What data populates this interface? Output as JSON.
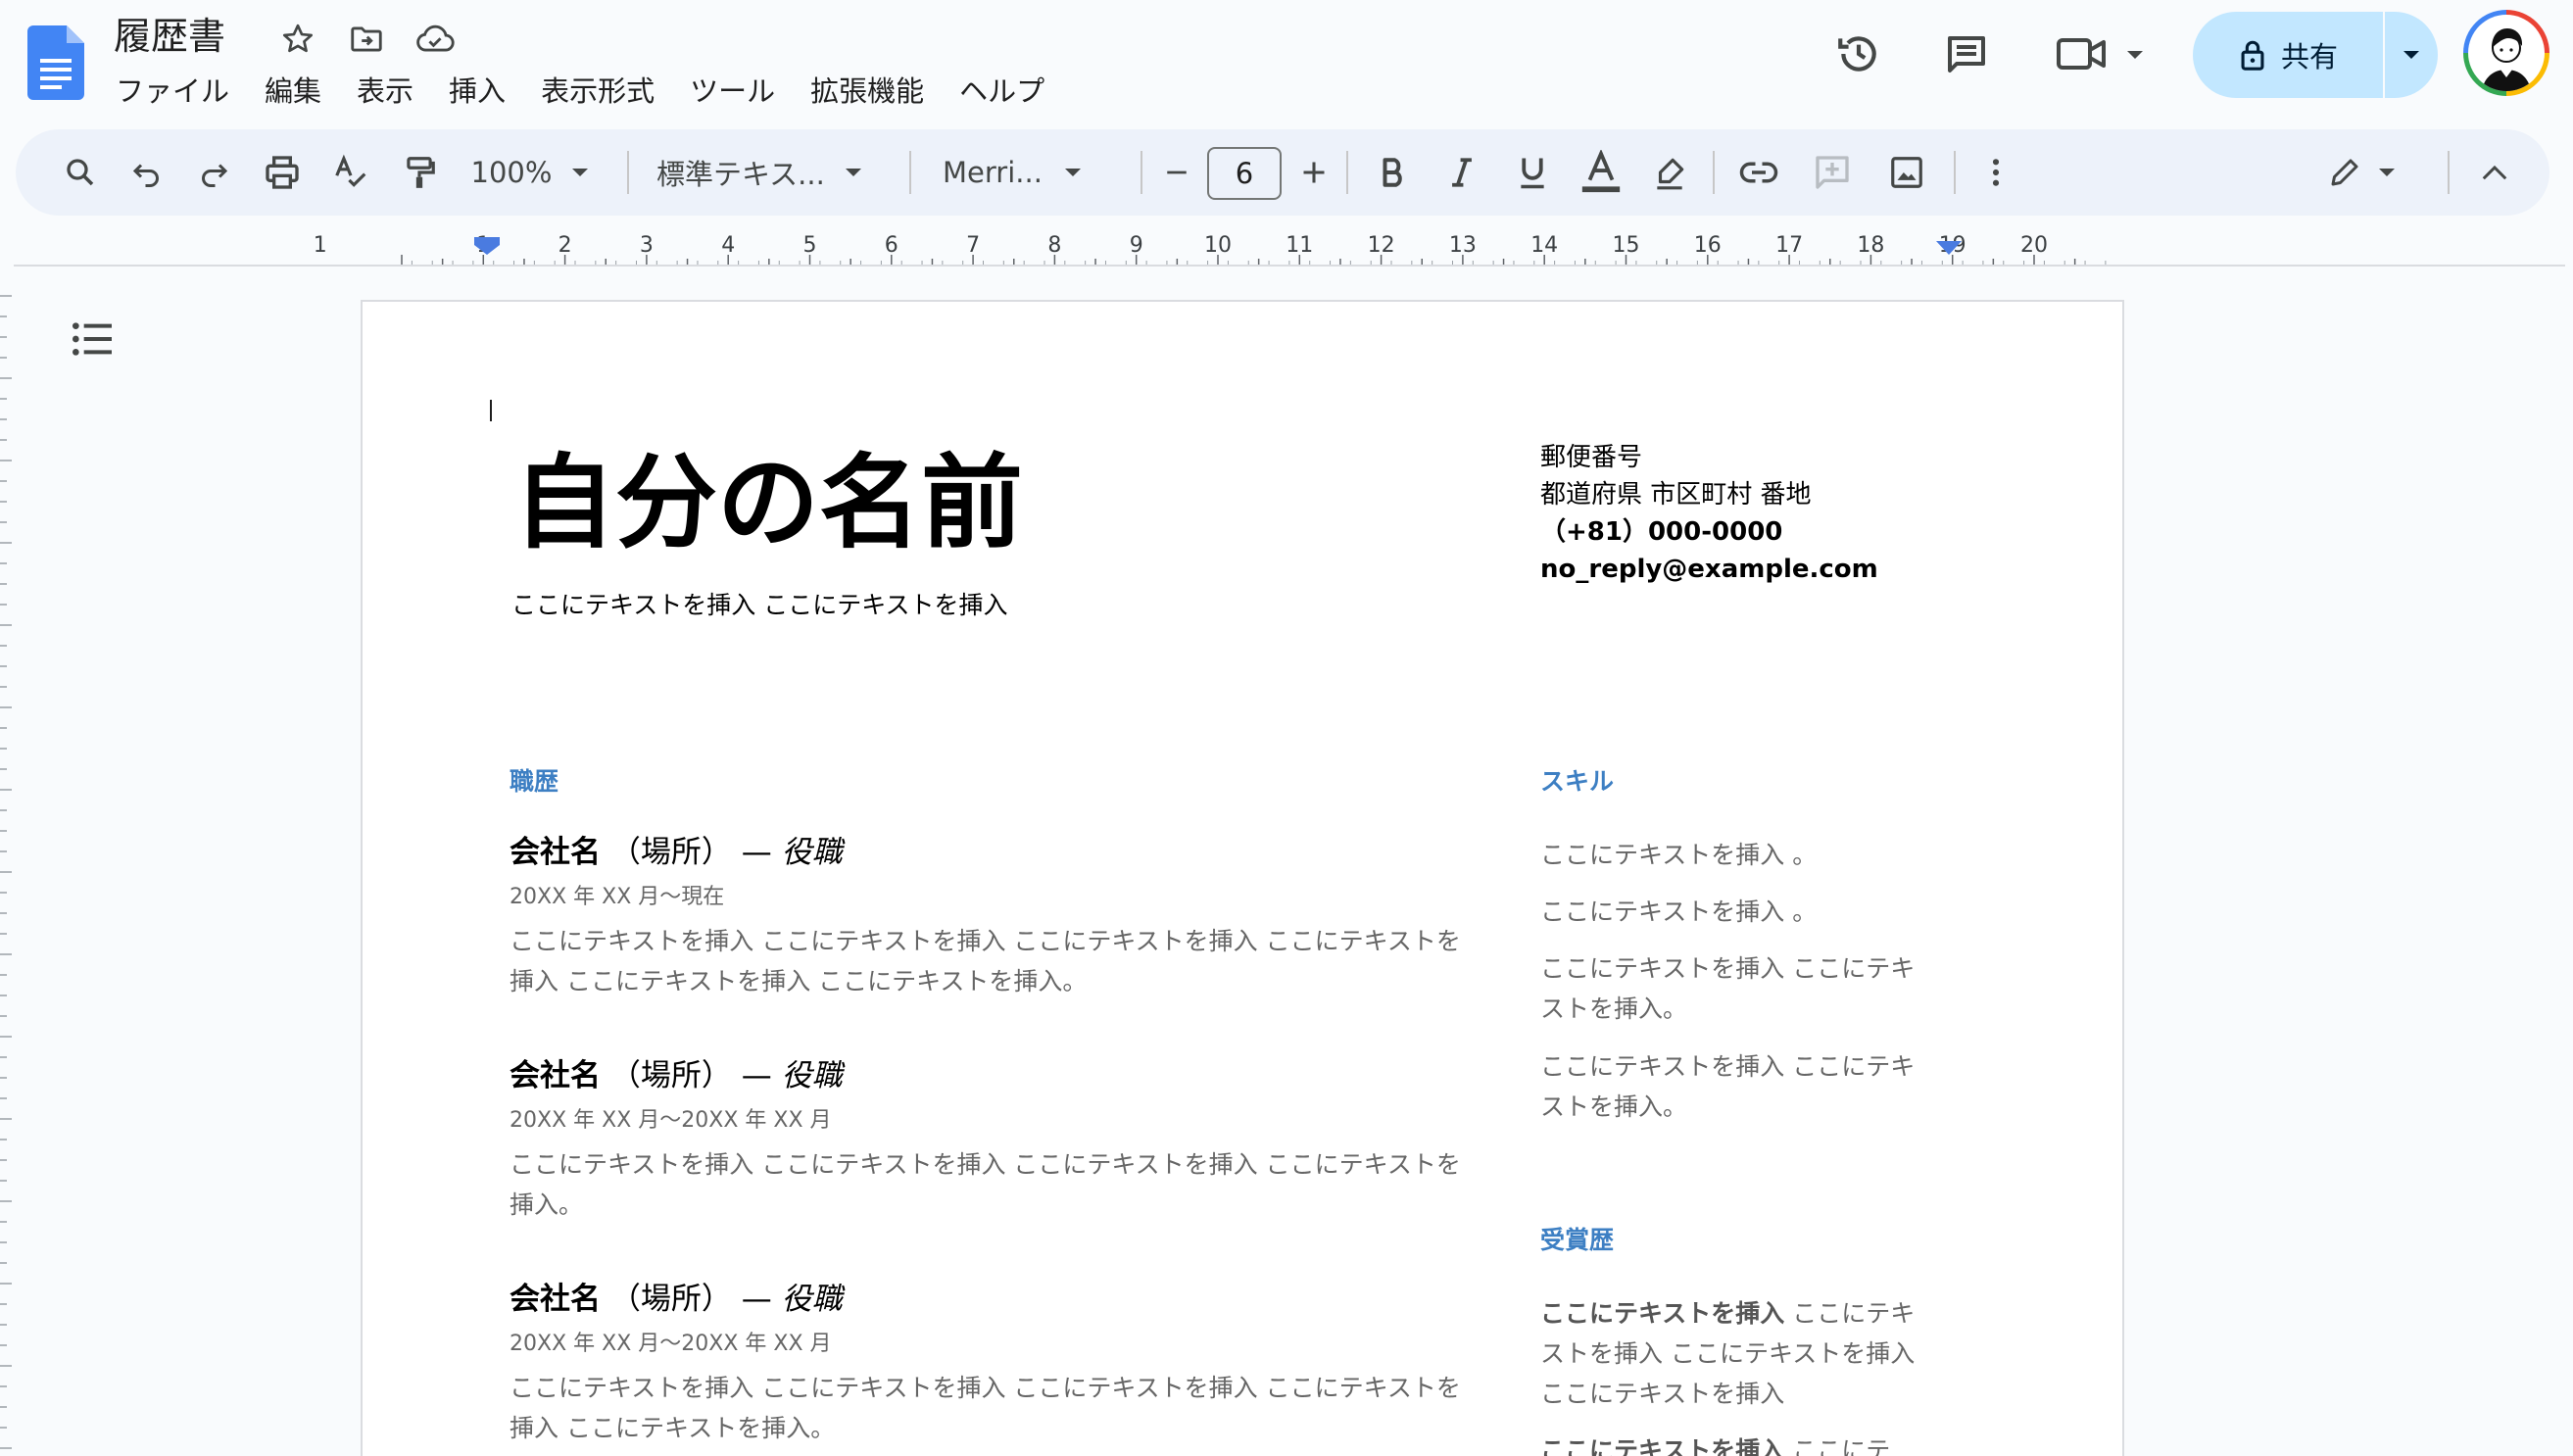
{
  "header": {
    "doc_title": "履歴書",
    "share_label": "共有"
  },
  "menu": [
    "ファイル",
    "編集",
    "表示",
    "挿入",
    "表示形式",
    "ツール",
    "拡張機能",
    "ヘルプ"
  ],
  "toolbar": {
    "zoom": "100%",
    "style": "標準テキス...",
    "font": "Merri...",
    "font_size": "6"
  },
  "ruler": {
    "ticks": [
      "1",
      "1",
      "2",
      "3",
      "4",
      "5",
      "6",
      "7",
      "8",
      "9",
      "10",
      "11",
      "12",
      "13",
      "14",
      "15",
      "16",
      "17",
      "18",
      "19",
      "20"
    ]
  },
  "document": {
    "name": "自分の名前",
    "subtitle": "ここにテキストを挿入 ここにテキストを挿入",
    "contact": {
      "postal": "郵便番号",
      "address": "都道府県 市区町村 番地",
      "phone": "（+81）000-0000",
      "email": "no_reply@example.com"
    },
    "sections": {
      "experience": "職歴",
      "skills": "スキル",
      "awards": "受賞歴"
    },
    "jobs": [
      {
        "company": "会社名",
        "location": "（場所）",
        "dash": "—",
        "role": "役職",
        "dates": "20XX 年 XX 月〜現在",
        "desc": "ここにテキストを挿入 ここにテキストを挿入 ここにテキストを挿入 ここにテキストを挿入 ここにテキストを挿入 ここにテキストを挿入。"
      },
      {
        "company": "会社名",
        "location": "（場所）",
        "dash": "—",
        "role": "役職",
        "dates": "20XX 年 XX 月〜20XX 年 XX 月",
        "desc": "ここにテキストを挿入 ここにテキストを挿入 ここにテキストを挿入 ここにテキストを挿入。"
      },
      {
        "company": "会社名",
        "location": "（場所）",
        "dash": "—",
        "role": "役職",
        "dates": "20XX 年 XX 月〜20XX 年 XX 月",
        "desc": "ここにテキストを挿入 ここにテキストを挿入 ここにテキストを挿入 ここにテキストを挿入 ここにテキストを挿入。"
      }
    ],
    "skills": [
      "ここにテキストを挿入 。",
      "ここにテキストを挿入 。",
      "ここにテキストを挿入 ここにテキストを挿入。",
      "ここにテキストを挿入 ここにテキストを挿入。"
    ],
    "awards": [
      {
        "bold": "ここにテキストを挿入",
        "rest": " ここにテキストを挿入 ここにテキストを挿入 ここにテキストを挿入"
      },
      {
        "bold": "ここにテキストを挿入",
        "rest": " ここにテ"
      }
    ]
  },
  "colors": {
    "accent": "#3d7fc3",
    "share_bg": "#c2e7ff",
    "toolbar_bg": "#edf2fa",
    "docs_blue": "#4285f4"
  },
  "icons": [
    "docs-logo-icon",
    "star-icon",
    "move-folder-icon",
    "cloud-saved-icon",
    "history-icon",
    "comment-icon",
    "meet-icon",
    "lock-icon",
    "search-icon",
    "undo-icon",
    "redo-icon",
    "print-icon",
    "spellcheck-icon",
    "paint-format-icon",
    "bold-icon",
    "italic-icon",
    "underline-icon",
    "text-color-icon",
    "highlight-icon",
    "link-icon",
    "add-comment-icon",
    "image-icon",
    "more-icon",
    "edit-mode-icon",
    "collapse-icon",
    "outline-icon"
  ]
}
